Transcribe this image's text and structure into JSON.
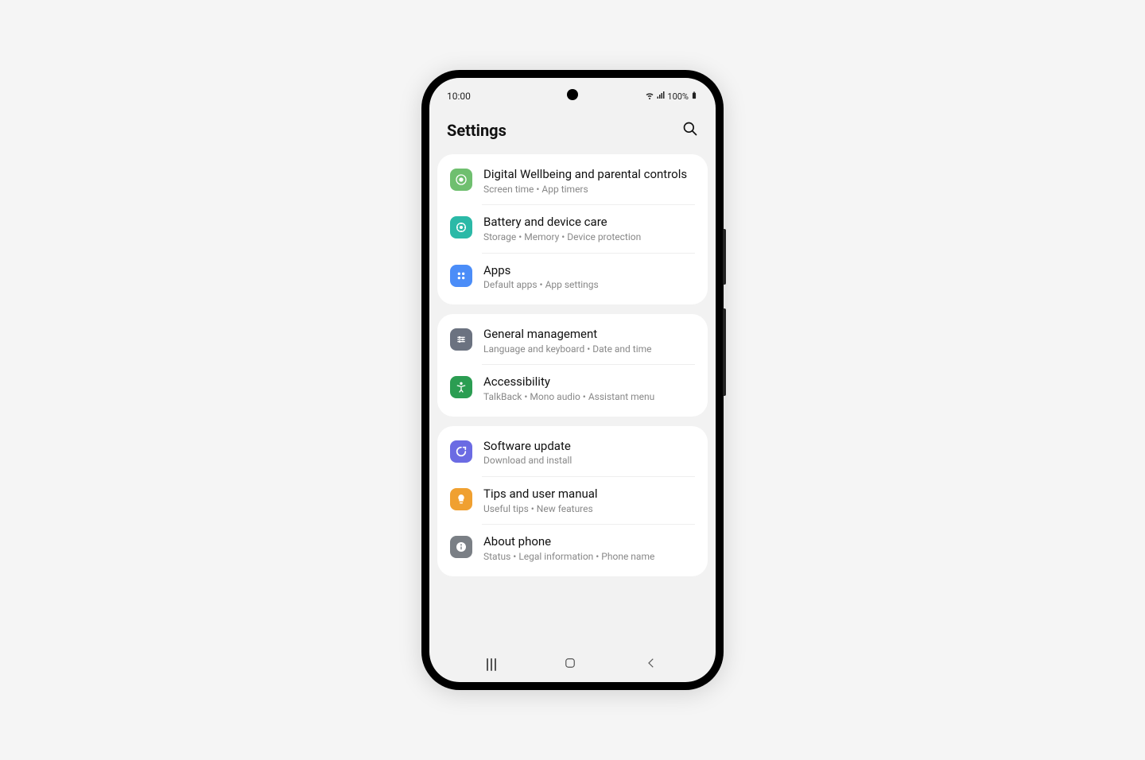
{
  "status": {
    "time": "10:00",
    "battery": "100%"
  },
  "header": {
    "title": "Settings"
  },
  "groups": [
    {
      "items": [
        {
          "title": "Digital Wellbeing and parental controls",
          "sub": "Screen time  •  App timers",
          "color": "#6fbf6f",
          "icon": "wellbeing"
        },
        {
          "title": "Battery and device care",
          "sub": "Storage  •  Memory  •  Device protection",
          "color": "#2bb9a7",
          "icon": "care"
        },
        {
          "title": "Apps",
          "sub": "Default apps  •  App settings",
          "color": "#4b8df8",
          "icon": "apps"
        }
      ]
    },
    {
      "items": [
        {
          "title": "General management",
          "sub": "Language and keyboard  •  Date and time",
          "color": "#6b7280",
          "icon": "general"
        },
        {
          "title": "Accessibility",
          "sub": "TalkBack  •  Mono audio  •  Assistant menu",
          "color": "#2b9d52",
          "icon": "accessibility"
        }
      ]
    },
    {
      "items": [
        {
          "title": "Software update",
          "sub": "Download and install",
          "color": "#6b6be3",
          "icon": "update"
        },
        {
          "title": "Tips and user manual",
          "sub": "Useful tips  •  New features",
          "color": "#f0a030",
          "icon": "tips"
        },
        {
          "title": "About phone",
          "sub": "Status  •  Legal information  •  Phone name",
          "color": "#7a7f85",
          "icon": "about"
        }
      ]
    }
  ]
}
